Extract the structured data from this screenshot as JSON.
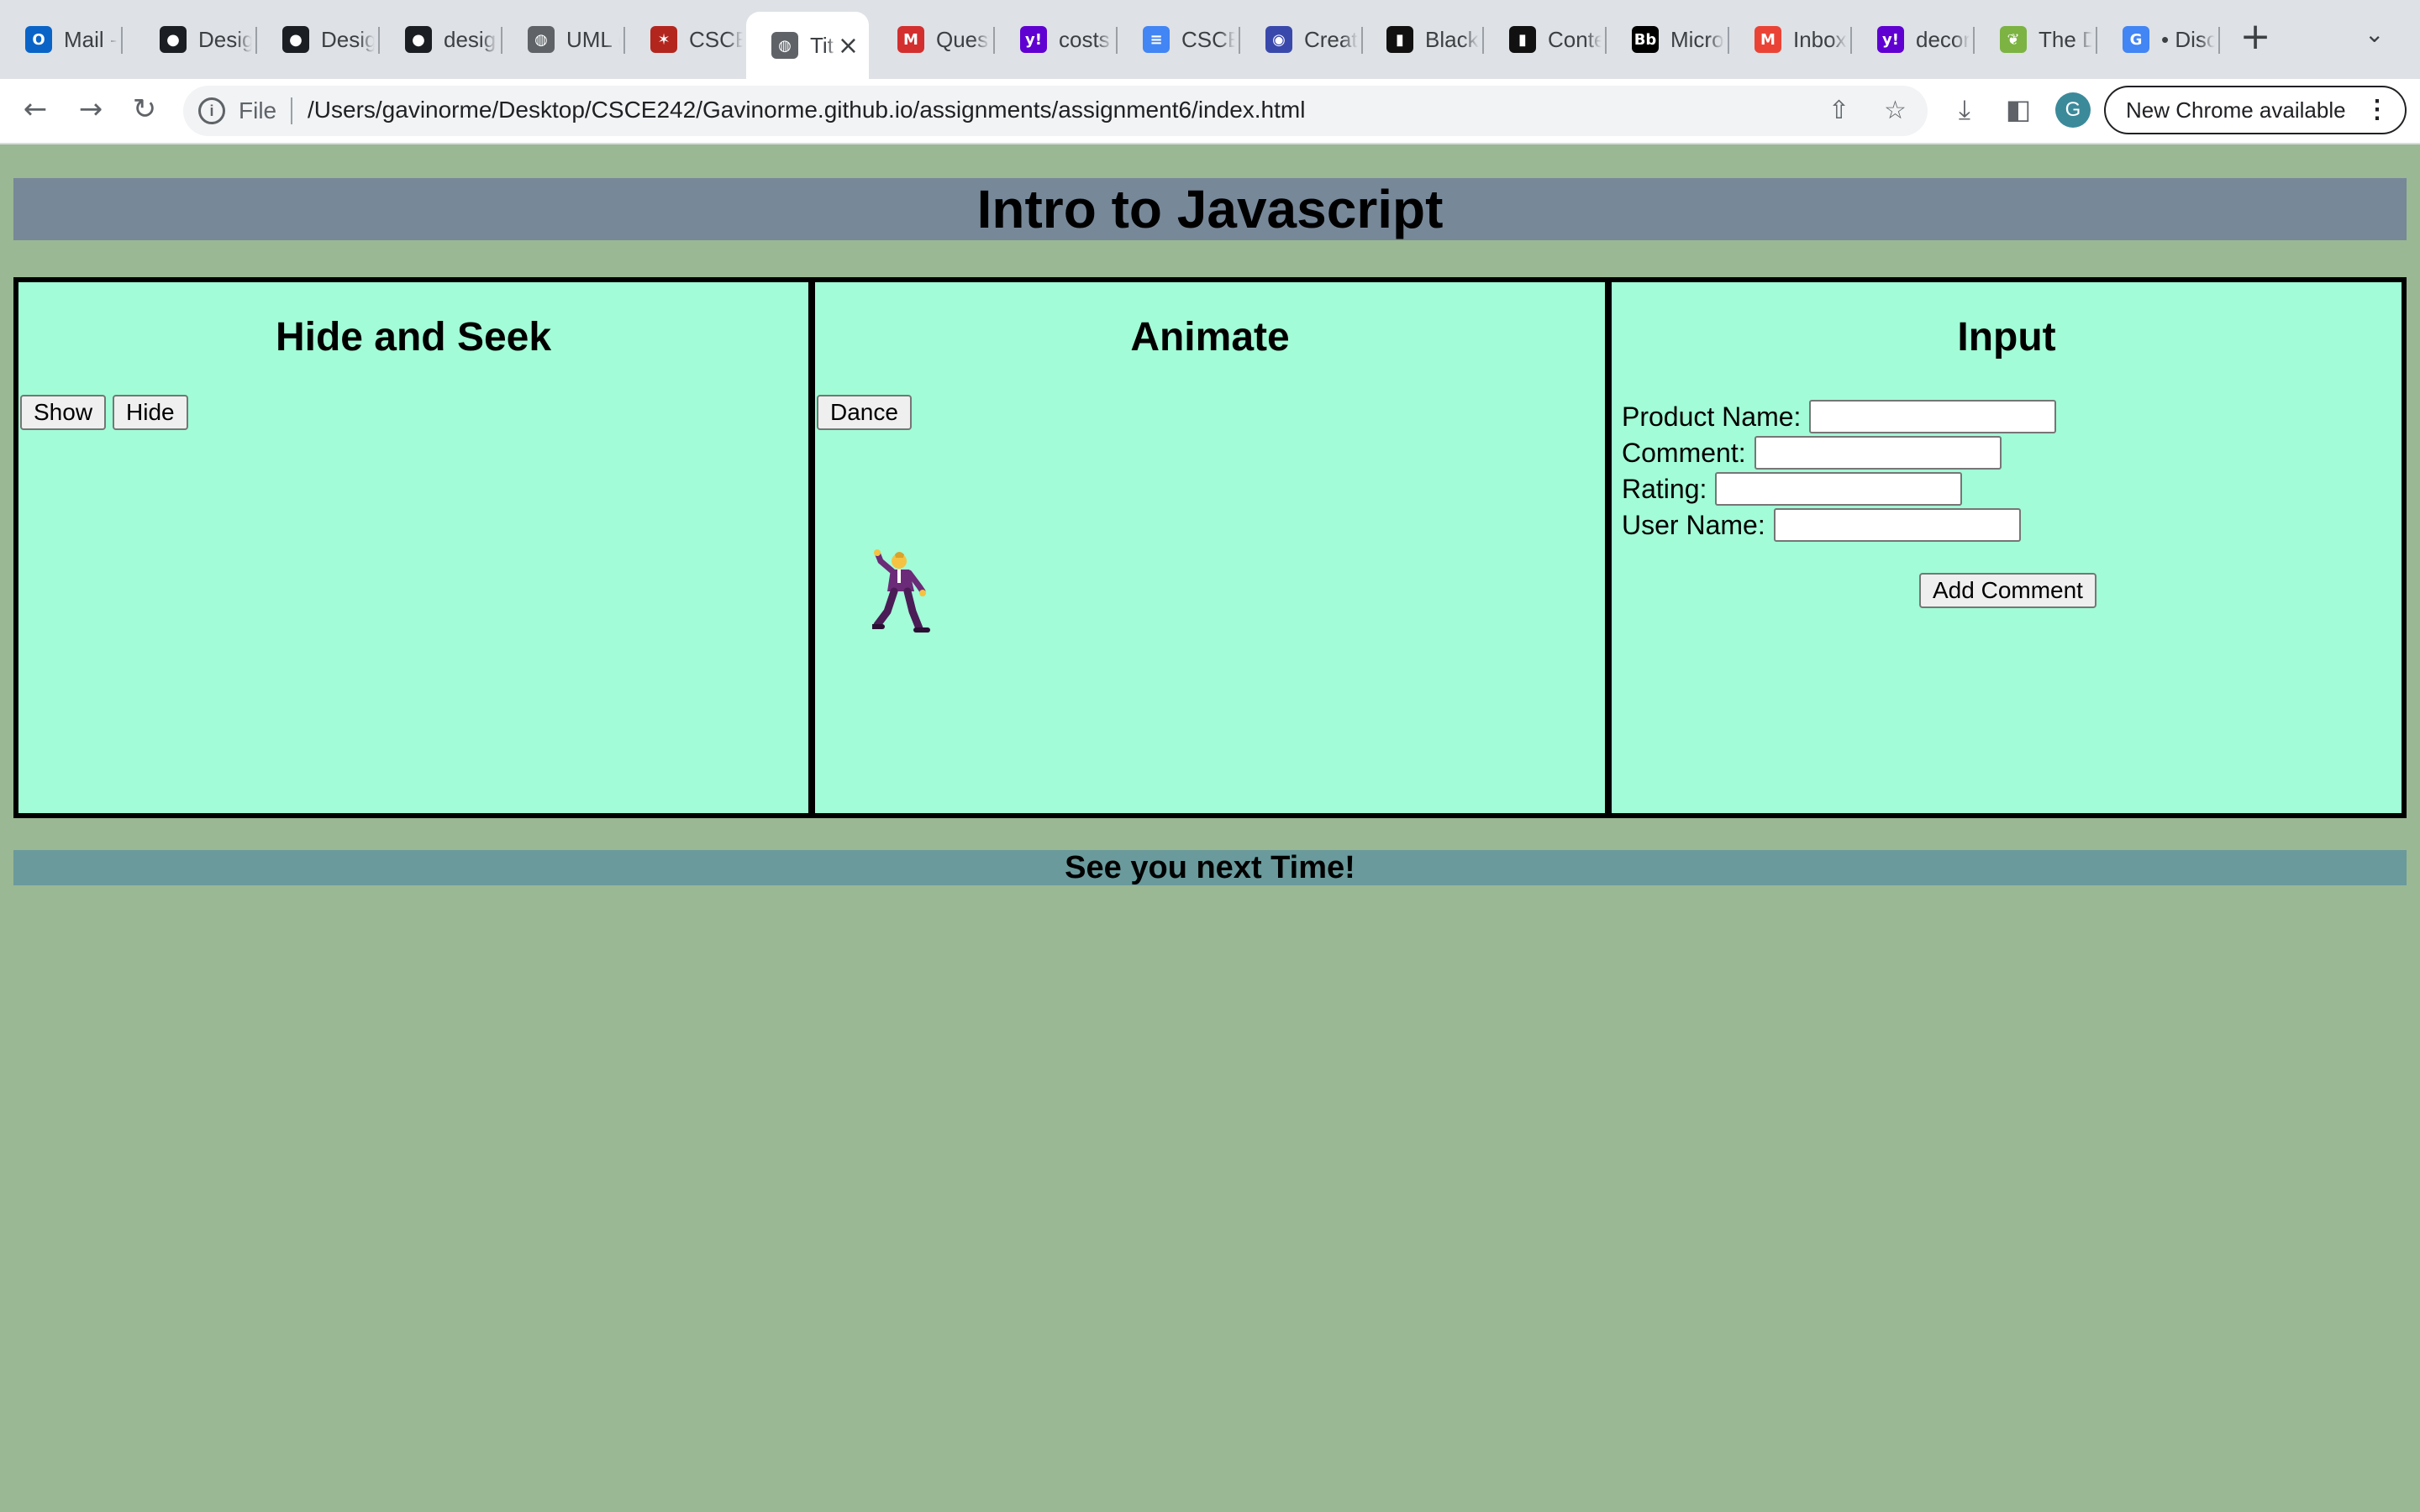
{
  "browser": {
    "tabs": [
      {
        "label": "Mail -",
        "icon": "outlook-icon",
        "color": "#0a64c8"
      },
      {
        "label": "Desig",
        "icon": "github-icon",
        "color": "#1b1f23"
      },
      {
        "label": "Desig",
        "icon": "github-icon",
        "color": "#1b1f23"
      },
      {
        "label": "desig",
        "icon": "github-icon",
        "color": "#1b1f23"
      },
      {
        "label": "UML (",
        "icon": "globe-icon",
        "color": "#5f6368"
      },
      {
        "label": "CSCE",
        "icon": "dancer-icon",
        "color": "#b3261e"
      },
      {
        "label": "Tit",
        "icon": "globe-icon",
        "color": "#5f6368",
        "active": true
      },
      {
        "label": "Quest",
        "icon": "m-icon",
        "color": "#d32f2f"
      },
      {
        "label": "costs",
        "icon": "yahoo-icon",
        "color": "#6001d2"
      },
      {
        "label": "CSCE",
        "icon": "docs-icon",
        "color": "#4285f4"
      },
      {
        "label": "Create",
        "icon": "owl-icon",
        "color": "#3949ab"
      },
      {
        "label": "Blackl",
        "icon": "chart-icon",
        "color": "#111111"
      },
      {
        "label": "Conte",
        "icon": "chart-icon",
        "color": "#111111"
      },
      {
        "label": "Micro",
        "icon": "blackboard-icon",
        "color": "#000000"
      },
      {
        "label": "Inbox",
        "icon": "gmail-icon",
        "color": "#ea4335"
      },
      {
        "label": "decor",
        "icon": "yahoo-icon",
        "color": "#6001d2"
      },
      {
        "label": "The D",
        "icon": "leaf-icon",
        "color": "#7cb342"
      },
      {
        "label": "• Disc",
        "icon": "google-icon",
        "color": "#4285f4"
      }
    ],
    "file_label": "File",
    "url": "/Users/gavinorme/Desktop/CSCE242/Gavinorme.github.io/assignments/assignment6/index.html",
    "avatar_letter": "G",
    "update_label": "New Chrome available"
  },
  "page": {
    "title": "Intro to Javascript",
    "panels": {
      "hide_seek": {
        "heading": "Hide and Seek",
        "show_label": "Show",
        "hide_label": "Hide"
      },
      "animate": {
        "heading": "Animate",
        "dance_label": "Dance"
      },
      "input": {
        "heading": "Input",
        "product_name_label": "Product Name:",
        "comment_label": "Comment:",
        "rating_label": "Rating:",
        "user_name_label": "User Name:",
        "product_name_value": "",
        "comment_value": "",
        "rating_value": "",
        "user_name_value": "",
        "add_comment_label": "Add Comment"
      }
    },
    "footer": "See you next Time!"
  },
  "colors": {
    "body_bg": "#9ab893",
    "header_bg": "#778899",
    "panel_bg": "#a2fcd7",
    "footer_bg": "#6a9a9c"
  }
}
